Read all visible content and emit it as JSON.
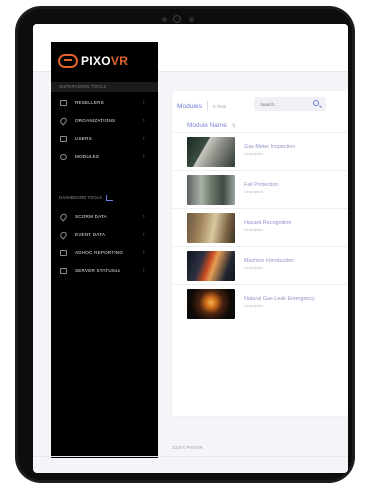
{
  "app": {
    "brand_prefix": "PIXO",
    "brand_suffix": "VR"
  },
  "sidebar": {
    "section_superadmin": "SUPERADMIN TOOLS",
    "superadmin_items": [
      {
        "label": "RESELLERS",
        "icon": "building-icon"
      },
      {
        "label": "ORGANIZATIONS",
        "icon": "tag-icon"
      },
      {
        "label": "USERS",
        "icon": "users-icon"
      },
      {
        "label": "MODULES",
        "icon": "layers-icon"
      }
    ],
    "section_dashboard": "DASHBOARD TOOLS",
    "dashboard_items": [
      {
        "label": "SCORM DATA",
        "icon": "tag-icon"
      },
      {
        "label": "EVENT DATA",
        "icon": "tag-icon"
      },
      {
        "label": "ADHOC REPORTING",
        "icon": "table-icon"
      },
      {
        "label": "SERVER STATUSxx",
        "icon": "server-icon"
      }
    ]
  },
  "main": {
    "title": "Modules",
    "total": "0 Total",
    "search_placeholder": "Search...",
    "column_header": "Module Name",
    "modules": [
      {
        "name": "Gas Meter Inspection",
        "desc": "Description"
      },
      {
        "name": "Fall Protection",
        "desc": "Description"
      },
      {
        "name": "Hazard Recognition",
        "desc": "Description"
      },
      {
        "name": "Machine Introduction",
        "desc": "Description"
      },
      {
        "name": "Natural Gas Leak Emergency",
        "desc": "Description"
      }
    ]
  },
  "footer": {
    "text": "2019 © PIXOVR"
  },
  "colors": {
    "accent": "#6d7bd6",
    "brand": "#e0642b",
    "sidebar_bg": "#000000"
  }
}
